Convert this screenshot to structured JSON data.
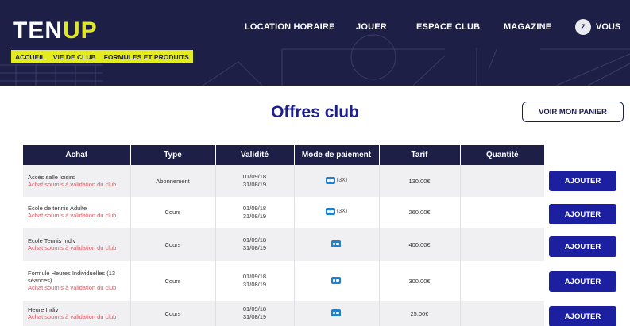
{
  "header": {
    "logo_part1": "TEN",
    "logo_part2": "UP",
    "nav": {
      "location": "LOCATION HORAIRE",
      "jouer": "JOUER",
      "espace": "ESPACE CLUB",
      "magazine": "MAGAZINE"
    },
    "account": {
      "avatar_initial": "Z",
      "label": "VOUS"
    },
    "subnav": {
      "accueil": "ACCUEIL",
      "vie": "VIE DE CLUB",
      "formules": "FORMULES ET PRODUITS"
    },
    "colors": {
      "background": "#1d1f47",
      "accent": "#e4ec1f"
    }
  },
  "page": {
    "title": "Offres club",
    "cart_button": "VOIR MON PANIER"
  },
  "table": {
    "columns": [
      "Achat",
      "Type",
      "Validité",
      "Mode de paiement",
      "Tarif",
      "Quantité"
    ],
    "rows": [
      {
        "name": "Accès salle loisirs",
        "note": "Achat soumis à validation du club",
        "type": "Abonnement",
        "from": "01/09/18",
        "to": "31/08/19",
        "payment_icon": "credit-card-icon",
        "payment_mult": "(3X)",
        "tarif": "130.00€",
        "quantite": "",
        "action": "AJOUTER"
      },
      {
        "name": "Ecole de tennis Adulte",
        "note": "Achat soumis à validation du club",
        "type": "Cours",
        "from": "01/09/18",
        "to": "31/08/19",
        "payment_icon": "credit-card-icon",
        "payment_mult": "(3X)",
        "tarif": "260.00€",
        "quantite": "",
        "action": "AJOUTER"
      },
      {
        "name": "Ecole Tennis Indiv",
        "note": "Achat soumis à validation du club",
        "type": "Cours",
        "from": "01/09/18",
        "to": "31/08/19",
        "payment_icon": "credit-card-icon",
        "payment_mult": "",
        "tarif": "400.00€",
        "quantite": "",
        "action": "AJOUTER"
      },
      {
        "name": "Formule Heures Individuelles (13 séances)",
        "note": "Achat soumis à validation du club",
        "type": "Cours",
        "from": "01/09/18",
        "to": "31/08/19",
        "payment_icon": "credit-card-icon",
        "payment_mult": "",
        "tarif": "300.00€",
        "quantite": "",
        "action": "AJOUTER"
      },
      {
        "name": "Heure Indiv",
        "note": "Achat soumis à validation du club",
        "type": "Cours",
        "from": "01/09/18",
        "to": "31/08/19",
        "payment_icon": "credit-card-icon",
        "payment_mult": "",
        "tarif": "25.00€",
        "quantite": "",
        "action": "AJOUTER"
      }
    ],
    "colors": {
      "header_bg": "#1d1f47",
      "note": "#e8565f",
      "action_bg": "#1c1fa0",
      "payment_icon": "#2180c9"
    }
  }
}
